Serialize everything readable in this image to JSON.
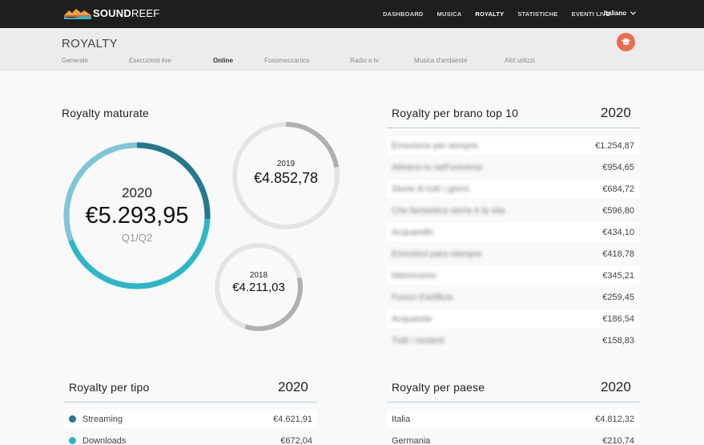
{
  "brand": {
    "name_bold": "SOUND",
    "name_thin": "REEF"
  },
  "nav": {
    "items": [
      {
        "label": "DASHBOARD",
        "active": false
      },
      {
        "label": "MUSICA",
        "active": false
      },
      {
        "label": "ROYALTY",
        "active": true
      },
      {
        "label": "STATISTICHE",
        "active": false
      },
      {
        "label": "EVENTI LIVE",
        "active": false
      }
    ],
    "language": "Italiano"
  },
  "page": {
    "title": "ROYALTY",
    "tabs": [
      {
        "label": "Generale",
        "active": false
      },
      {
        "label": "Esecuzioni live",
        "active": false
      },
      {
        "label": "Online",
        "active": true
      },
      {
        "label": "Fonomeccanico",
        "active": false
      },
      {
        "label": "Radio e tv",
        "active": false
      },
      {
        "label": "Musica d'ambiente",
        "active": false
      },
      {
        "label": "Altri utilizzi",
        "active": false
      }
    ]
  },
  "maturate": {
    "title": "Royalty maturate",
    "main": {
      "year": "2020",
      "amount": "€5.293,95",
      "period": "Q1/Q2"
    },
    "prev1": {
      "year": "2019",
      "amount": "€4.852,78"
    },
    "prev2": {
      "year": "2018",
      "amount": "€4.211,03"
    }
  },
  "top10": {
    "title": "Royalty per brano top 10",
    "year": "2020",
    "rows": [
      {
        "name": "Emozione per sempre",
        "value": "€1.254,87"
      },
      {
        "name": "Almeno tu nell'universo",
        "value": "€954,65"
      },
      {
        "name": "Storie di tutti i giorni",
        "value": "€684,72"
      },
      {
        "name": "Che fantastica storia è la vita",
        "value": "€596,80"
      },
      {
        "name": "Acquarello",
        "value": "€434,10"
      },
      {
        "name": "Emozioni para siempre",
        "value": "€418,78"
      },
      {
        "name": "Metronomo",
        "value": "€345,21"
      },
      {
        "name": "Fuoco d'artificio",
        "value": "€259,45"
      },
      {
        "name": "Acquarela",
        "value": "€186,54"
      },
      {
        "name": "Tutti i restanti",
        "value": "€158,83"
      }
    ]
  },
  "per_tipo": {
    "title": "Royalty per tipo",
    "year": "2020",
    "rows": [
      {
        "label": "Streaming",
        "value": "€4.621,91",
        "color": "#24798f"
      },
      {
        "label": "Downloads",
        "value": "€672,04",
        "color": "#2ab8c8"
      }
    ]
  },
  "per_paese": {
    "title": "Royalty per paese",
    "year": "2020",
    "rows": [
      {
        "label": "Italia",
        "value": "€4.812,32"
      },
      {
        "label": "Germania",
        "value": "€210,74"
      }
    ]
  },
  "colors": {
    "accent": "#ec6b4e",
    "ring_dark": "#24798f",
    "ring_mid": "#2ab8c8",
    "ring_light": "#7fc6d6",
    "ring_grey": "#b0b0b0",
    "ring_grey_light": "#e4e4e4"
  },
  "icons": {
    "logo": "mountain-wave-logo",
    "language": "chevron-down-icon",
    "education": "graduation-cap-icon"
  }
}
